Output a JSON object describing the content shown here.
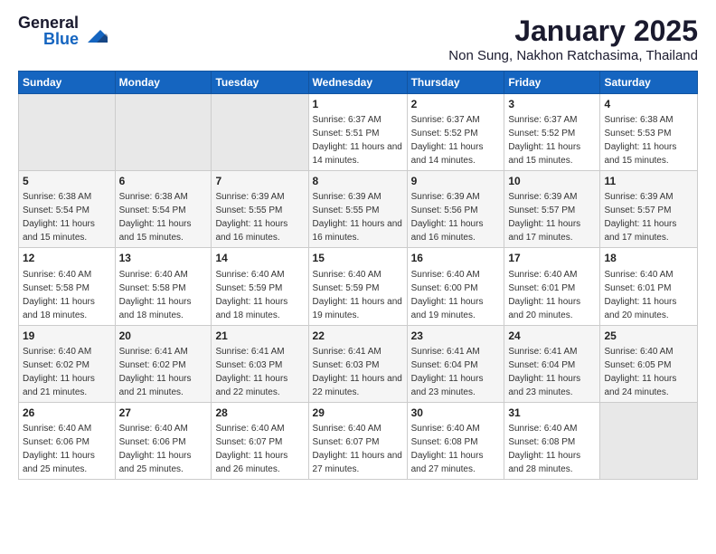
{
  "header": {
    "logo_general": "General",
    "logo_blue": "Blue",
    "title": "January 2025",
    "subtitle": "Non Sung, Nakhon Ratchasima, Thailand"
  },
  "calendar": {
    "days_of_week": [
      "Sunday",
      "Monday",
      "Tuesday",
      "Wednesday",
      "Thursday",
      "Friday",
      "Saturday"
    ],
    "weeks": [
      [
        {
          "day": "",
          "empty": true
        },
        {
          "day": "",
          "empty": true
        },
        {
          "day": "",
          "empty": true
        },
        {
          "day": "1",
          "sunrise": "6:37 AM",
          "sunset": "5:51 PM",
          "daylight": "11 hours and 14 minutes."
        },
        {
          "day": "2",
          "sunrise": "6:37 AM",
          "sunset": "5:52 PM",
          "daylight": "11 hours and 14 minutes."
        },
        {
          "day": "3",
          "sunrise": "6:37 AM",
          "sunset": "5:52 PM",
          "daylight": "11 hours and 15 minutes."
        },
        {
          "day": "4",
          "sunrise": "6:38 AM",
          "sunset": "5:53 PM",
          "daylight": "11 hours and 15 minutes."
        }
      ],
      [
        {
          "day": "5",
          "sunrise": "6:38 AM",
          "sunset": "5:54 PM",
          "daylight": "11 hours and 15 minutes."
        },
        {
          "day": "6",
          "sunrise": "6:38 AM",
          "sunset": "5:54 PM",
          "daylight": "11 hours and 15 minutes."
        },
        {
          "day": "7",
          "sunrise": "6:39 AM",
          "sunset": "5:55 PM",
          "daylight": "11 hours and 16 minutes."
        },
        {
          "day": "8",
          "sunrise": "6:39 AM",
          "sunset": "5:55 PM",
          "daylight": "11 hours and 16 minutes."
        },
        {
          "day": "9",
          "sunrise": "6:39 AM",
          "sunset": "5:56 PM",
          "daylight": "11 hours and 16 minutes."
        },
        {
          "day": "10",
          "sunrise": "6:39 AM",
          "sunset": "5:57 PM",
          "daylight": "11 hours and 17 minutes."
        },
        {
          "day": "11",
          "sunrise": "6:39 AM",
          "sunset": "5:57 PM",
          "daylight": "11 hours and 17 minutes."
        }
      ],
      [
        {
          "day": "12",
          "sunrise": "6:40 AM",
          "sunset": "5:58 PM",
          "daylight": "11 hours and 18 minutes."
        },
        {
          "day": "13",
          "sunrise": "6:40 AM",
          "sunset": "5:58 PM",
          "daylight": "11 hours and 18 minutes."
        },
        {
          "day": "14",
          "sunrise": "6:40 AM",
          "sunset": "5:59 PM",
          "daylight": "11 hours and 18 minutes."
        },
        {
          "day": "15",
          "sunrise": "6:40 AM",
          "sunset": "5:59 PM",
          "daylight": "11 hours and 19 minutes."
        },
        {
          "day": "16",
          "sunrise": "6:40 AM",
          "sunset": "6:00 PM",
          "daylight": "11 hours and 19 minutes."
        },
        {
          "day": "17",
          "sunrise": "6:40 AM",
          "sunset": "6:01 PM",
          "daylight": "11 hours and 20 minutes."
        },
        {
          "day": "18",
          "sunrise": "6:40 AM",
          "sunset": "6:01 PM",
          "daylight": "11 hours and 20 minutes."
        }
      ],
      [
        {
          "day": "19",
          "sunrise": "6:40 AM",
          "sunset": "6:02 PM",
          "daylight": "11 hours and 21 minutes."
        },
        {
          "day": "20",
          "sunrise": "6:41 AM",
          "sunset": "6:02 PM",
          "daylight": "11 hours and 21 minutes."
        },
        {
          "day": "21",
          "sunrise": "6:41 AM",
          "sunset": "6:03 PM",
          "daylight": "11 hours and 22 minutes."
        },
        {
          "day": "22",
          "sunrise": "6:41 AM",
          "sunset": "6:03 PM",
          "daylight": "11 hours and 22 minutes."
        },
        {
          "day": "23",
          "sunrise": "6:41 AM",
          "sunset": "6:04 PM",
          "daylight": "11 hours and 23 minutes."
        },
        {
          "day": "24",
          "sunrise": "6:41 AM",
          "sunset": "6:04 PM",
          "daylight": "11 hours and 23 minutes."
        },
        {
          "day": "25",
          "sunrise": "6:40 AM",
          "sunset": "6:05 PM",
          "daylight": "11 hours and 24 minutes."
        }
      ],
      [
        {
          "day": "26",
          "sunrise": "6:40 AM",
          "sunset": "6:06 PM",
          "daylight": "11 hours and 25 minutes."
        },
        {
          "day": "27",
          "sunrise": "6:40 AM",
          "sunset": "6:06 PM",
          "daylight": "11 hours and 25 minutes."
        },
        {
          "day": "28",
          "sunrise": "6:40 AM",
          "sunset": "6:07 PM",
          "daylight": "11 hours and 26 minutes."
        },
        {
          "day": "29",
          "sunrise": "6:40 AM",
          "sunset": "6:07 PM",
          "daylight": "11 hours and 27 minutes."
        },
        {
          "day": "30",
          "sunrise": "6:40 AM",
          "sunset": "6:08 PM",
          "daylight": "11 hours and 27 minutes."
        },
        {
          "day": "31",
          "sunrise": "6:40 AM",
          "sunset": "6:08 PM",
          "daylight": "11 hours and 28 minutes."
        },
        {
          "day": "",
          "empty": true
        }
      ]
    ]
  }
}
